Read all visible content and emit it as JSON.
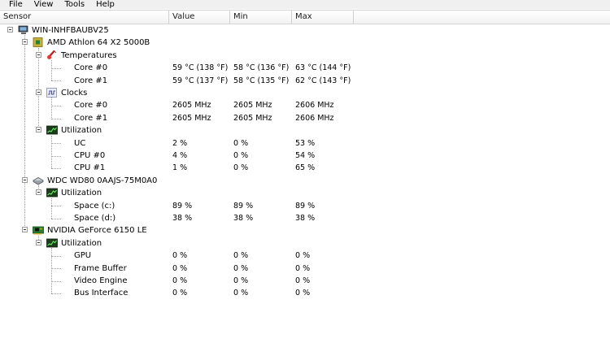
{
  "menu": [
    "File",
    "View",
    "Tools",
    "Help"
  ],
  "columns": {
    "sensor": "Sensor",
    "value": "Value",
    "min": "Min",
    "max": "Max"
  },
  "tree": [
    {
      "level": 0,
      "icon": "computer-icon",
      "label": "WIN-INHFBAUBV25",
      "expander": true
    },
    {
      "level": 1,
      "icon": "cpu-chip-icon",
      "label": "AMD Athlon 64 X2 5000B",
      "expander": true
    },
    {
      "level": 2,
      "icon": "thermometer-icon",
      "label": "Temperatures",
      "expander": true
    },
    {
      "level": 3,
      "label": "Core #0",
      "value": "59 °C  (138 °F)",
      "min": "58 °C  (136 °F)",
      "max": "63 °C  (144 °F)"
    },
    {
      "level": 3,
      "label": "Core #1",
      "value": "59 °C  (137 °F)",
      "min": "58 °C  (135 °F)",
      "max": "62 °C  (143 °F)"
    },
    {
      "level": 2,
      "icon": "clock-wave-icon",
      "label": "Clocks",
      "expander": true
    },
    {
      "level": 3,
      "label": "Core #0",
      "value": "2605 MHz",
      "min": "2605 MHz",
      "max": "2606 MHz"
    },
    {
      "level": 3,
      "label": "Core #1",
      "value": "2605 MHz",
      "min": "2605 MHz",
      "max": "2606 MHz"
    },
    {
      "level": 2,
      "icon": "utilization-graph-icon",
      "label": "Utilization",
      "expander": true
    },
    {
      "level": 3,
      "label": "UC",
      "value": "2 %",
      "min": "0 %",
      "max": "53 %"
    },
    {
      "level": 3,
      "label": "CPU #0",
      "value": "4 %",
      "min": "0 %",
      "max": "54 %"
    },
    {
      "level": 3,
      "label": "CPU #1",
      "value": "1 %",
      "min": "0 %",
      "max": "65 %"
    },
    {
      "level": 1,
      "icon": "hard-drive-icon",
      "label": "WDC WD80 0AAJS-75M0A0",
      "expander": true
    },
    {
      "level": 2,
      "icon": "utilization-graph-icon",
      "label": "Utilization",
      "expander": true
    },
    {
      "level": 3,
      "label": "Space (c:)",
      "value": "89 %",
      "min": "89 %",
      "max": "89 %"
    },
    {
      "level": 3,
      "label": "Space (d:)",
      "value": "38 %",
      "min": "38 %",
      "max": "38 %"
    },
    {
      "level": 1,
      "icon": "graphics-card-icon",
      "label": "NVIDIA GeForce 6150 LE",
      "expander": true
    },
    {
      "level": 2,
      "icon": "utilization-graph-icon",
      "label": "Utilization",
      "expander": true
    },
    {
      "level": 3,
      "label": "GPU",
      "value": "0 %",
      "min": "0 %",
      "max": "0 %"
    },
    {
      "level": 3,
      "label": "Frame Buffer",
      "value": "0 %",
      "min": "0 %",
      "max": "0 %"
    },
    {
      "level": 3,
      "label": "Video Engine",
      "value": "0 %",
      "min": "0 %",
      "max": "0 %"
    },
    {
      "level": 3,
      "label": "Bus Interface",
      "value": "0 %",
      "min": "0 %",
      "max": "0 %"
    }
  ]
}
